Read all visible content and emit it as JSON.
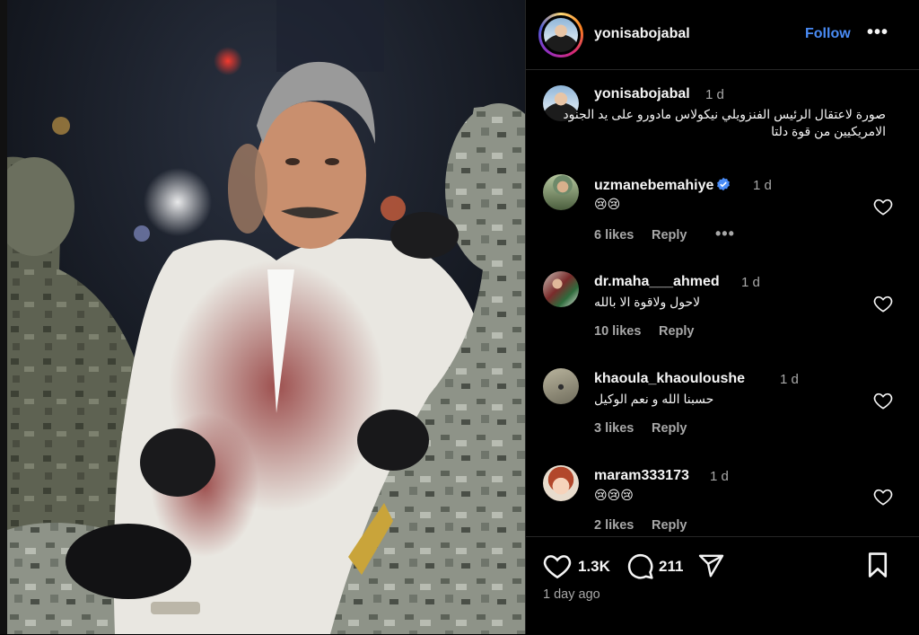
{
  "post": {
    "author": "yonisabojabal",
    "follow_label": "Follow",
    "more_label": "•••",
    "caption": {
      "author": "yonisabojabal",
      "time": "1 d",
      "text": "صورة لاعتقال الرئيس الفنزويلي نيكولاس مادورو على يد الجنود الامريكيين من قوة دلتا"
    },
    "likes_count": "1.3K",
    "comments_count": "211",
    "posted_time": "1 day ago"
  },
  "comments": [
    {
      "username": "uzmanebemahiye",
      "time": "1 d",
      "text": "😢😢",
      "likes": "6 likes",
      "reply": "Reply",
      "more": "•••",
      "verified": true
    },
    {
      "username": "dr.maha___ahmed",
      "time": "1 d",
      "text": "لاحول ولاقوة الا بالله",
      "likes": "10 likes",
      "reply": "Reply"
    },
    {
      "username": "khaoula_khaouloushe",
      "time": "1 d",
      "text": "حسبنا الله و نعم الوكيل",
      "likes": "3 likes",
      "reply": "Reply"
    },
    {
      "username": "maram333173",
      "time": "1 d",
      "text": "😢😢😢",
      "likes": "2 likes",
      "reply": "Reply"
    }
  ],
  "colors": {
    "background": "#000000",
    "text_primary": "#f5f5f5",
    "text_secondary": "#a8a8a8",
    "follow_blue": "#4a8cf6",
    "divider": "#262626"
  },
  "icons": [
    "heart-icon",
    "comment-icon",
    "share-icon",
    "bookmark-icon",
    "verified-badge-icon"
  ]
}
